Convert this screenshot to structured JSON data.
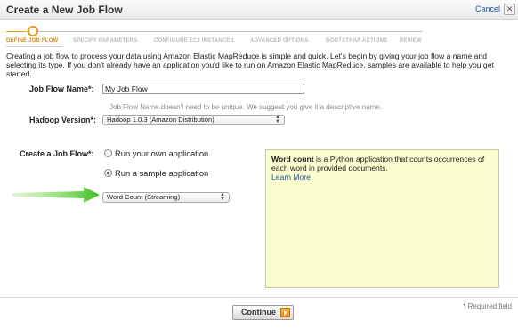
{
  "window": {
    "title": "Create a New Job Flow",
    "cancel_label": "Cancel",
    "close_glyph": "✕"
  },
  "wizard": {
    "steps": [
      {
        "label": "DEFINE JOB FLOW",
        "active": true
      },
      {
        "label": "SPECIFY PARAMETERS",
        "active": false
      },
      {
        "label": "CONFIGURE EC2 INSTANCES",
        "active": false
      },
      {
        "label": "ADVANCED OPTIONS",
        "active": false
      },
      {
        "label": "BOOTSTRAP ACTIONS",
        "active": false
      },
      {
        "label": "REVIEW",
        "active": false
      }
    ]
  },
  "intro_text": "Creating a job flow to process your data using Amazon Elastic MapReduce is simple and quick. Let's begin by giving your job flow a name and selecting its type. If you don't already have an application you'd like to run on Amazon Elastic MapReduce, samples are available to help you get started.",
  "form": {
    "job_flow_name_label": "Job Flow Name*:",
    "job_flow_name_value": "My Job Flow",
    "job_flow_name_hint": "Job Flow Name doesn't need to be unique. We suggest you give it a descriptive name.",
    "hadoop_version_label": "Hadoop Version*:",
    "hadoop_version_value": "Hadoop 1.0.3 (Amazon Distribution)",
    "create_label": "Create a Job Flow*:",
    "radio_own": "Run your own application",
    "radio_sample": "Run a sample application",
    "radio_selected": "sample",
    "sample_select_value": "Word Count (Streaming)"
  },
  "info_box": {
    "bold_lead": "Word count",
    "text": " is a Python application that counts occurrences of each word in provided documents.",
    "link": "Learn More"
  },
  "footer": {
    "required_note": "* Required field",
    "continue_label": "Continue"
  },
  "colors": {
    "accent_orange": "#e59a1c",
    "link_blue": "#1a57a6",
    "info_bg": "#fbfccf",
    "arrow_green": "#4cc52a"
  }
}
